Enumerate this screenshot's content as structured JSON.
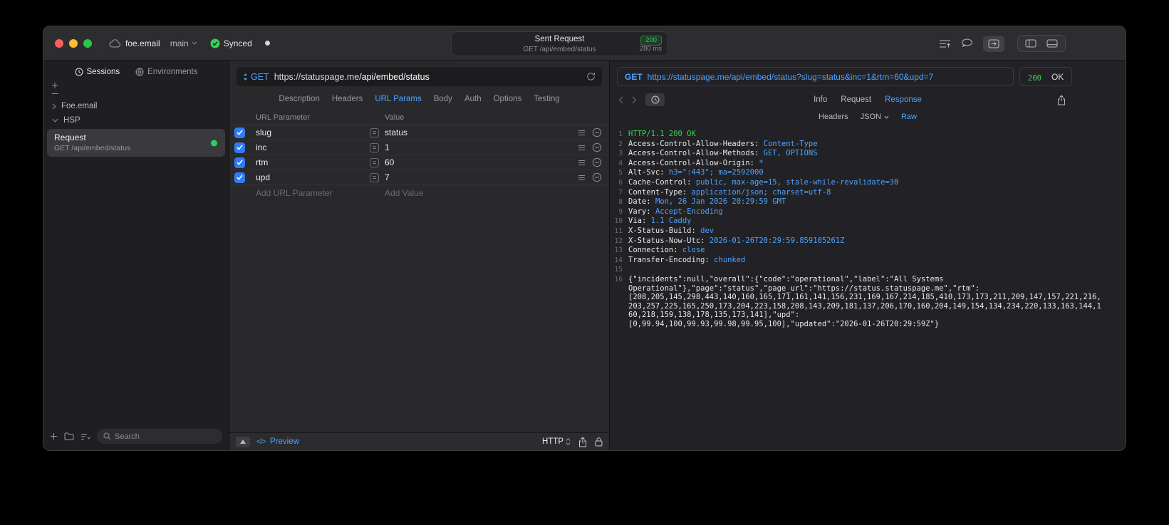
{
  "titlebar": {
    "project": "foe.email",
    "branch": "main",
    "sync_label": "Synced",
    "request_summary": {
      "title": "Sent Request",
      "status_code": "200",
      "method_path": "GET /api/embed/status",
      "duration": "280 ms"
    }
  },
  "sidebar": {
    "tabs": [
      {
        "label": "Sessions"
      },
      {
        "label": "Environments"
      }
    ],
    "tree": [
      {
        "label": "Foe.email"
      },
      {
        "label": "HSP"
      }
    ],
    "request_item": {
      "title": "Request",
      "subtitle": "GET /api/embed/status"
    },
    "search_placeholder": "Search"
  },
  "icons": {
    "code_preview": "</>"
  },
  "request_editor": {
    "method": "GET",
    "url_host": "https://statuspage.me",
    "url_path": "/api/embed/status",
    "tabs": [
      "Description",
      "Headers",
      "URL Params",
      "Body",
      "Auth",
      "Options",
      "Testing"
    ],
    "active_tab": "URL Params",
    "param_table": {
      "headers": [
        "URL Parameter",
        "Value"
      ],
      "rows": [
        {
          "name": "slug",
          "value": "status",
          "checked": true
        },
        {
          "name": "inc",
          "value": "1",
          "checked": true
        },
        {
          "name": "rtm",
          "value": "60",
          "checked": true
        },
        {
          "name": "upd",
          "value": "7",
          "checked": true
        }
      ],
      "add_name_placeholder": "Add URL Parameter",
      "add_value_placeholder": "Add Value"
    },
    "footer": {
      "preview_label": "Preview",
      "protocol_label": "HTTP"
    }
  },
  "response_viewer": {
    "method": "GET",
    "url": "https://statuspage.me/api/embed/status?slug=status&inc=1&rtm=60&upd=7",
    "status": {
      "code": "200",
      "text": "OK"
    },
    "tabs": [
      "Info",
      "Request",
      "Response"
    ],
    "active_tab": "Response",
    "subtabs": [
      "Headers",
      "JSON",
      "Raw"
    ],
    "active_subtab": "Raw",
    "body_lines": [
      {
        "num": "1",
        "parts": [
          {
            "t": "HTTP/1.1 200 OK",
            "c": "ok"
          }
        ]
      },
      {
        "num": "2",
        "parts": [
          {
            "t": "Access-Control-Allow-Headers: ",
            "c": "k"
          },
          {
            "t": "Content-Type",
            "c": "v"
          }
        ]
      },
      {
        "num": "3",
        "parts": [
          {
            "t": "Access-Control-Allow-Methods: ",
            "c": "k"
          },
          {
            "t": "GET, OPTIONS",
            "c": "v"
          }
        ]
      },
      {
        "num": "4",
        "parts": [
          {
            "t": "Access-Control-Allow-Origin: ",
            "c": "k"
          },
          {
            "t": "*",
            "c": "v"
          }
        ]
      },
      {
        "num": "5",
        "parts": [
          {
            "t": "Alt-Svc: ",
            "c": "k"
          },
          {
            "t": "h3=\":443\"; ma=2592000",
            "c": "v"
          }
        ]
      },
      {
        "num": "6",
        "parts": [
          {
            "t": "Cache-Control: ",
            "c": "k"
          },
          {
            "t": "public, max-age=15, stale-while-revalidate=30",
            "c": "v"
          }
        ]
      },
      {
        "num": "7",
        "parts": [
          {
            "t": "Content-Type: ",
            "c": "k"
          },
          {
            "t": "application/json; charset=utf-8",
            "c": "v"
          }
        ]
      },
      {
        "num": "8",
        "parts": [
          {
            "t": "Date: ",
            "c": "k"
          },
          {
            "t": "Mon, 26 Jan 2026 20:29:59 GMT",
            "c": "v"
          }
        ]
      },
      {
        "num": "9",
        "parts": [
          {
            "t": "Vary: ",
            "c": "k"
          },
          {
            "t": "Accept-Encoding",
            "c": "v"
          }
        ]
      },
      {
        "num": "10",
        "parts": [
          {
            "t": "Via: ",
            "c": "k"
          },
          {
            "t": "1.1 Caddy",
            "c": "v"
          }
        ]
      },
      {
        "num": "11",
        "parts": [
          {
            "t": "X-Status-Build: ",
            "c": "k"
          },
          {
            "t": "dev",
            "c": "v"
          }
        ]
      },
      {
        "num": "12",
        "parts": [
          {
            "t": "X-Status-Now-Utc: ",
            "c": "k"
          },
          {
            "t": "2026-01-26T20:29:59.859105261Z",
            "c": "v"
          }
        ]
      },
      {
        "num": "13",
        "parts": [
          {
            "t": "Connection: ",
            "c": "k"
          },
          {
            "t": "close",
            "c": "v"
          }
        ]
      },
      {
        "num": "14",
        "parts": [
          {
            "t": "Transfer-Encoding: ",
            "c": "k"
          },
          {
            "t": "chunked",
            "c": "v"
          }
        ]
      },
      {
        "num": "15",
        "parts": []
      },
      {
        "num": "16",
        "parts": [
          {
            "t": "{\"incidents\":null,\"overall\":{\"code\":\"operational\",\"label\":\"All Systems\nOperational\"},\"page\":\"status\",\"page_url\":\"https://status.statuspage.me\",\"rtm\":\n[208,205,145,298,443,140,160,165,171,161,141,156,231,169,167,214,185,410,173,173,211,209,147,157,221,216,\n203,257,225,165,250,173,204,223,158,208,143,209,181,137,206,170,160,204,149,154,134,234,220,133,163,144,1\n60,218,159,138,178,135,173,141],\"upd\":\n[0,99.94,100,99.93,99.98,99.95,100],\"updated\":\"2026-01-26T20:29:59Z\"}",
            "c": "k"
          }
        ]
      }
    ]
  },
  "colors": {
    "accent_blue": "#4da2ff",
    "success_green": "#30d158",
    "checkbox_blue": "#2e7bf6",
    "window_background": "#28282b"
  }
}
